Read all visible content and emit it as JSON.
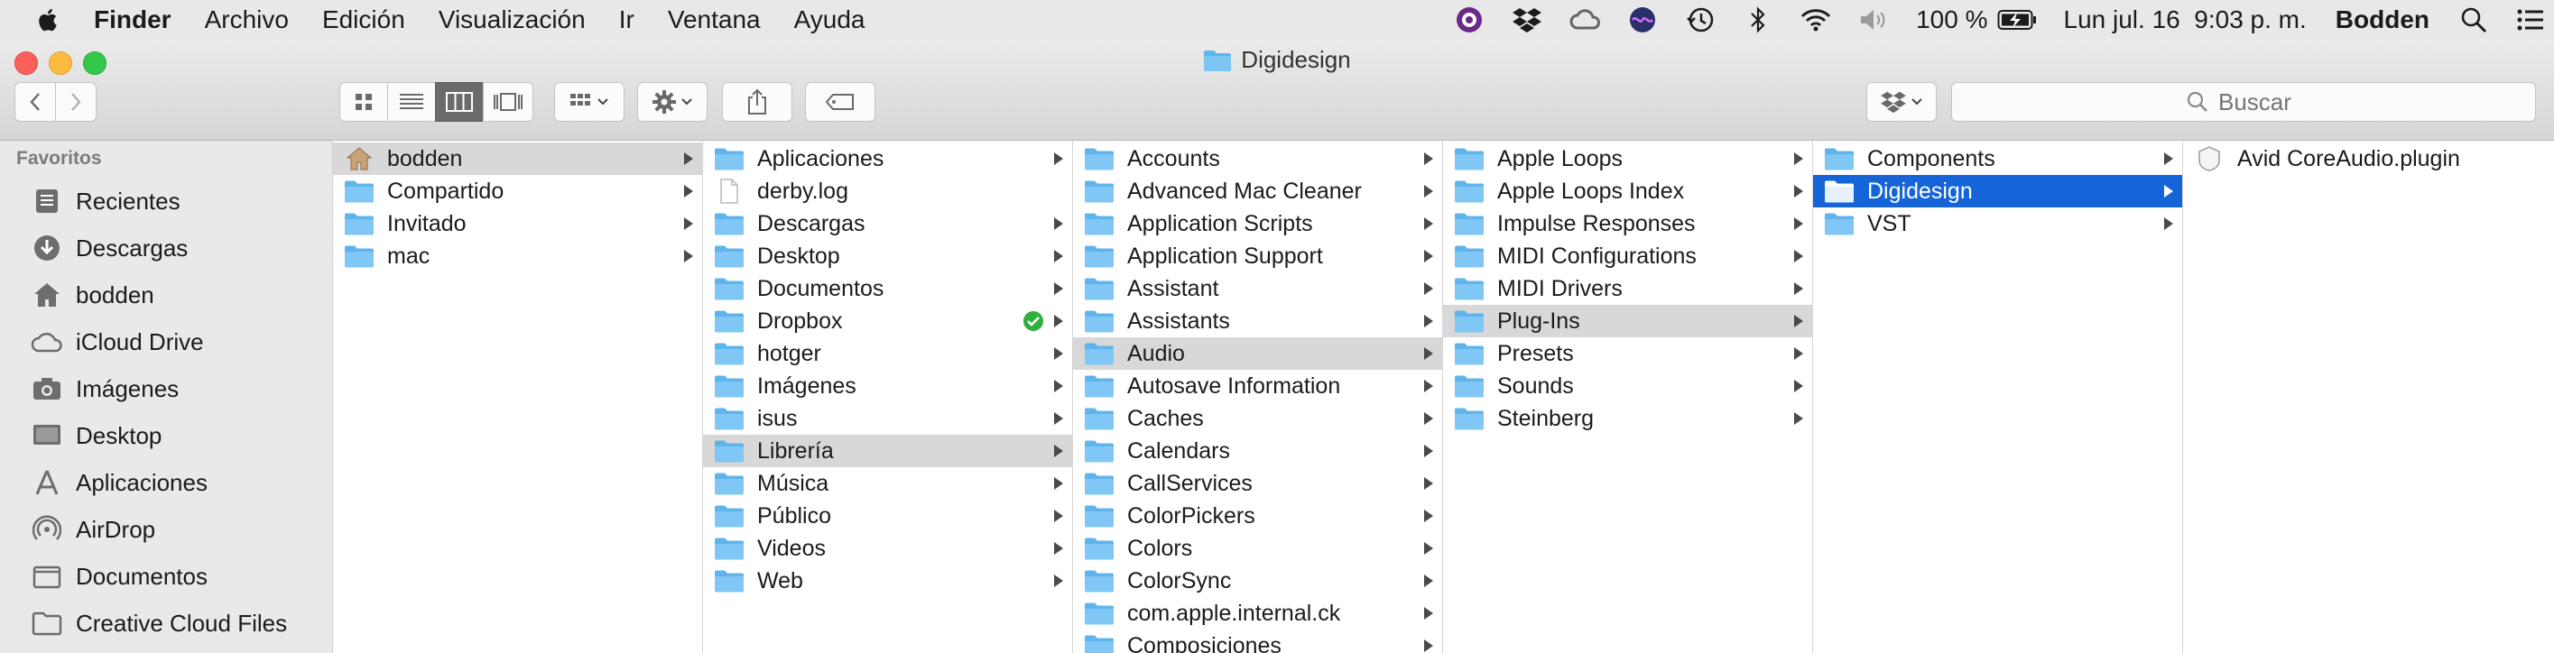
{
  "menubar": {
    "app": "Finder",
    "items": [
      "Archivo",
      "Edición",
      "Visualización",
      "Ir",
      "Ventana",
      "Ayuda"
    ],
    "battery": "100 %",
    "datetime": "Lun jul. 16  9:03 p. m.",
    "user": "Bodden"
  },
  "window": {
    "title": "Digidesign"
  },
  "search": {
    "placeholder": "Buscar"
  },
  "sidebar": {
    "section": "Favoritos",
    "items": [
      {
        "label": "Recientes",
        "icon": "recents-icon"
      },
      {
        "label": "Descargas",
        "icon": "downloads-icon"
      },
      {
        "label": "bodden",
        "icon": "home-icon"
      },
      {
        "label": "iCloud Drive",
        "icon": "cloud-icon"
      },
      {
        "label": "Imágenes",
        "icon": "camera-icon"
      },
      {
        "label": "Desktop",
        "icon": "desktop-icon"
      },
      {
        "label": "Aplicaciones",
        "icon": "applications-icon"
      },
      {
        "label": "AirDrop",
        "icon": "airdrop-icon"
      },
      {
        "label": "Documentos",
        "icon": "documents-icon"
      },
      {
        "label": "Creative Cloud Files",
        "icon": "folder-icon"
      }
    ]
  },
  "columns": [
    {
      "items": [
        {
          "label": "bodden",
          "icon": "home",
          "arrow": true,
          "selected": "gray"
        },
        {
          "label": "Compartido",
          "icon": "folder",
          "arrow": true
        },
        {
          "label": "Invitado",
          "icon": "folder",
          "arrow": true
        },
        {
          "label": "mac",
          "icon": "folder",
          "arrow": true
        }
      ]
    },
    {
      "items": [
        {
          "label": "Aplicaciones",
          "icon": "folder",
          "arrow": true
        },
        {
          "label": "derby.log",
          "icon": "file",
          "arrow": false
        },
        {
          "label": "Descargas",
          "icon": "folder",
          "arrow": true
        },
        {
          "label": "Desktop",
          "icon": "folder",
          "arrow": true
        },
        {
          "label": "Documentos",
          "icon": "folder",
          "arrow": true
        },
        {
          "label": "Dropbox",
          "icon": "folder",
          "arrow": true,
          "badge": true
        },
        {
          "label": "hotger",
          "icon": "folder",
          "arrow": true
        },
        {
          "label": "Imágenes",
          "icon": "folder",
          "arrow": true
        },
        {
          "label": "isus",
          "icon": "folder",
          "arrow": true
        },
        {
          "label": "Librería",
          "icon": "folder",
          "arrow": true,
          "selected": "gray"
        },
        {
          "label": "Música",
          "icon": "folder",
          "arrow": true
        },
        {
          "label": "Público",
          "icon": "folder",
          "arrow": true
        },
        {
          "label": "Videos",
          "icon": "folder",
          "arrow": true
        },
        {
          "label": "Web",
          "icon": "folder",
          "arrow": true
        }
      ]
    },
    {
      "items": [
        {
          "label": "Accounts",
          "icon": "folder",
          "arrow": true
        },
        {
          "label": "Advanced Mac Cleaner",
          "icon": "folder",
          "arrow": true
        },
        {
          "label": "Application Scripts",
          "icon": "folder",
          "arrow": true
        },
        {
          "label": "Application Support",
          "icon": "folder",
          "arrow": true
        },
        {
          "label": "Assistant",
          "icon": "folder",
          "arrow": true
        },
        {
          "label": "Assistants",
          "icon": "folder",
          "arrow": true
        },
        {
          "label": "Audio",
          "icon": "folder",
          "arrow": true,
          "selected": "gray"
        },
        {
          "label": "Autosave Information",
          "icon": "folder",
          "arrow": true
        },
        {
          "label": "Caches",
          "icon": "folder",
          "arrow": true
        },
        {
          "label": "Calendars",
          "icon": "folder",
          "arrow": true
        },
        {
          "label": "CallServices",
          "icon": "folder",
          "arrow": true
        },
        {
          "label": "ColorPickers",
          "icon": "folder",
          "arrow": true
        },
        {
          "label": "Colors",
          "icon": "folder",
          "arrow": true
        },
        {
          "label": "ColorSync",
          "icon": "folder",
          "arrow": true
        },
        {
          "label": "com.apple.internal.ck",
          "icon": "folder",
          "arrow": true
        },
        {
          "label": "Composiciones",
          "icon": "folder",
          "arrow": true
        }
      ]
    },
    {
      "items": [
        {
          "label": "Apple Loops",
          "icon": "folder",
          "arrow": true
        },
        {
          "label": "Apple Loops Index",
          "icon": "folder",
          "arrow": true
        },
        {
          "label": "Impulse Responses",
          "icon": "folder",
          "arrow": true
        },
        {
          "label": "MIDI Configurations",
          "icon": "folder",
          "arrow": true
        },
        {
          "label": "MIDI Drivers",
          "icon": "folder",
          "arrow": true
        },
        {
          "label": "Plug-Ins",
          "icon": "folder",
          "arrow": true,
          "selected": "gray"
        },
        {
          "label": "Presets",
          "icon": "folder",
          "arrow": true
        },
        {
          "label": "Sounds",
          "icon": "folder",
          "arrow": true
        },
        {
          "label": "Steinberg",
          "icon": "folder",
          "arrow": true
        }
      ]
    },
    {
      "items": [
        {
          "label": "Components",
          "icon": "folder",
          "arrow": true
        },
        {
          "label": "Digidesign",
          "icon": "folder",
          "arrow": true,
          "selected": "blue"
        },
        {
          "label": "VST",
          "icon": "folder",
          "arrow": true
        }
      ]
    },
    {
      "items": [
        {
          "label": "Avid CoreAudio.plugin",
          "icon": "plugin",
          "arrow": false
        }
      ]
    }
  ],
  "colors": {
    "selection_blue": "#1564d8",
    "selection_gray": "#d8d8d8",
    "folder_blue": "#5fb4ec",
    "close": "#fc605c",
    "minimize": "#fdbc40",
    "zoom": "#34c84a",
    "badge_green": "#2eb03c"
  }
}
